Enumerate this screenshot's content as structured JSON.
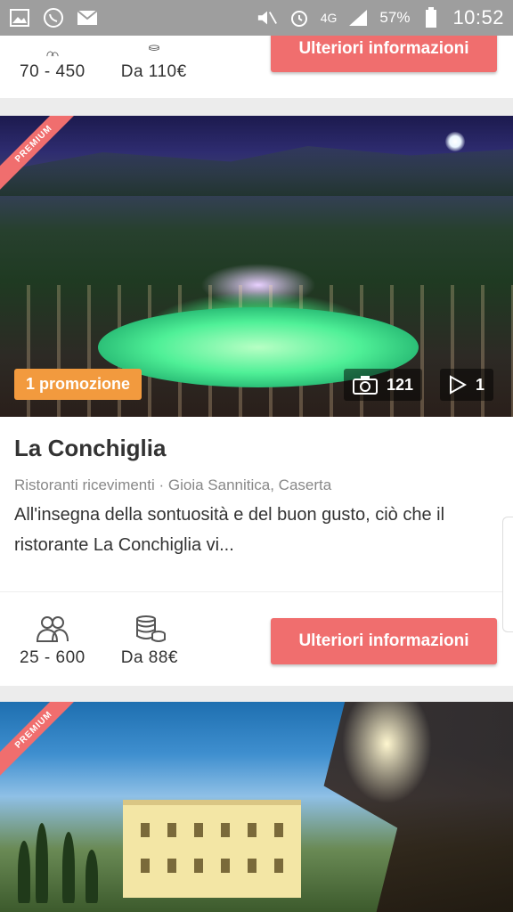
{
  "status_bar": {
    "network": "4G",
    "battery": "57%",
    "time": "10:52",
    "icons": [
      "gallery-icon",
      "whatsapp-icon",
      "mail-icon",
      "mute-icon",
      "alarm-icon",
      "signal-icon",
      "battery-icon"
    ]
  },
  "top_card": {
    "capacity": "70 - 450",
    "price": "Da 110€",
    "button_label": "Ulteriori informazioni"
  },
  "main_card": {
    "badge": "PREMIUM",
    "promo": "1 promozione",
    "photos_count": "121",
    "videos_count": "1",
    "title": "La Conchiglia",
    "subtitle": "Ristoranti ricevimenti · Gioia Sannitica, Caserta",
    "description": "All'insegna della sontuosità e del buon gusto, ciò che il ristorante La Conchiglia vi...",
    "capacity": "25 - 600",
    "price": "Da 88€",
    "button_label": "Ulteriori informazioni"
  },
  "bottom_card": {
    "badge": "PREMIUM"
  },
  "colors": {
    "accent": "#f06e6e",
    "promo": "#f29a3e",
    "status_bar": "#9e9e9e"
  }
}
